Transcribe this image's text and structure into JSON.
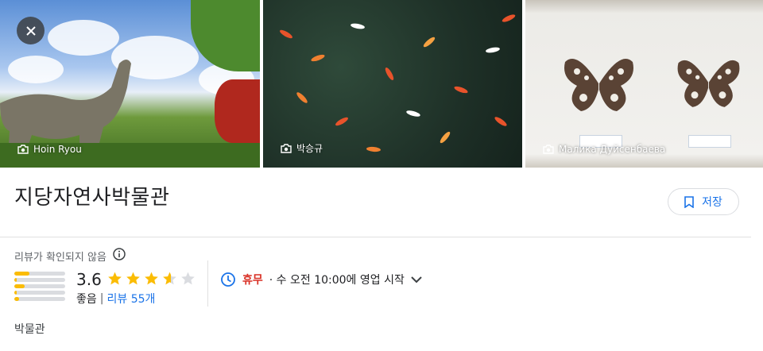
{
  "photos": [
    {
      "author": "Hoin Ryou"
    },
    {
      "author": "박승규"
    },
    {
      "author": "Малика Дуйсенбаева"
    }
  ],
  "place": {
    "name": "지당자연사박물관",
    "save_label": "저장",
    "unverified_label": "리뷰가 확인되지 않음",
    "rating": "3.6",
    "rating_value": 3.6,
    "rating_word": "좋음",
    "separator": "|",
    "reviews_label": "리뷰 55개",
    "rating_distribution": [
      0.3,
      0.05,
      0.2,
      0.05,
      0.1
    ],
    "hours_status": "휴무",
    "hours_detail": "· 수 오전 10:00에 영업 시작",
    "category": "박물관"
  },
  "colors": {
    "accent": "#1a73e8",
    "closed": "#d93025",
    "star": "#fbbc04"
  },
  "icons": [
    "close-icon",
    "camera-icon",
    "bookmark-icon",
    "info-icon",
    "star-icon",
    "clock-icon",
    "chevron-down-icon"
  ]
}
